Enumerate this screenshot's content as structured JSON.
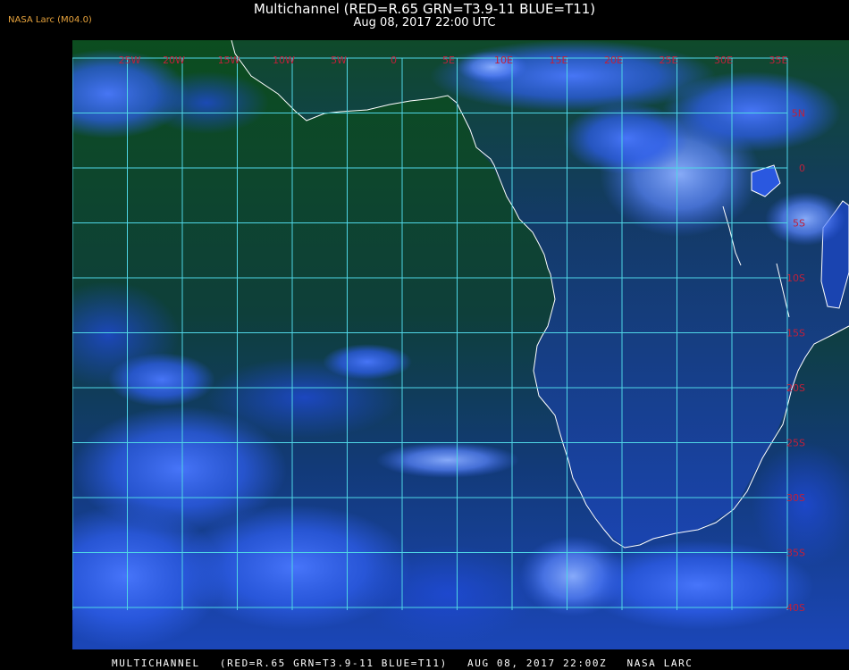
{
  "header": {
    "title": "Multichannel (RED=R.65 GRN=T3.9-11 BLUE=T11)",
    "datetime": "Aug 08, 2017 22:00 UTC",
    "source": "NASA Larc (M04.0)"
  },
  "map": {
    "longitude_labels": [
      "25W",
      "20W",
      "15W",
      "10W",
      "5W",
      "0",
      "5E",
      "10E",
      "15E",
      "20E",
      "25E",
      "30E",
      "35E"
    ],
    "latitude_labels": [
      "5N",
      "0",
      "5S",
      "10S",
      "15S",
      "20S",
      "25S",
      "30S",
      "35S",
      "40S"
    ],
    "colors": {
      "grid": "#4fd6e6",
      "coast": "#ffffff",
      "label": "#c0203a",
      "land": "#103d2a",
      "ocean": "#0b3f1c",
      "cloud": "#2f5ff0",
      "cloud_bright": "#7ea6ff"
    }
  },
  "footer": {
    "product": "MULTICHANNEL",
    "channels": "(RED=R.65 GRN=T3.9-11 BLUE=T11)",
    "datetime": "AUG 08, 2017 22:00Z",
    "agency": "NASA LARC"
  }
}
